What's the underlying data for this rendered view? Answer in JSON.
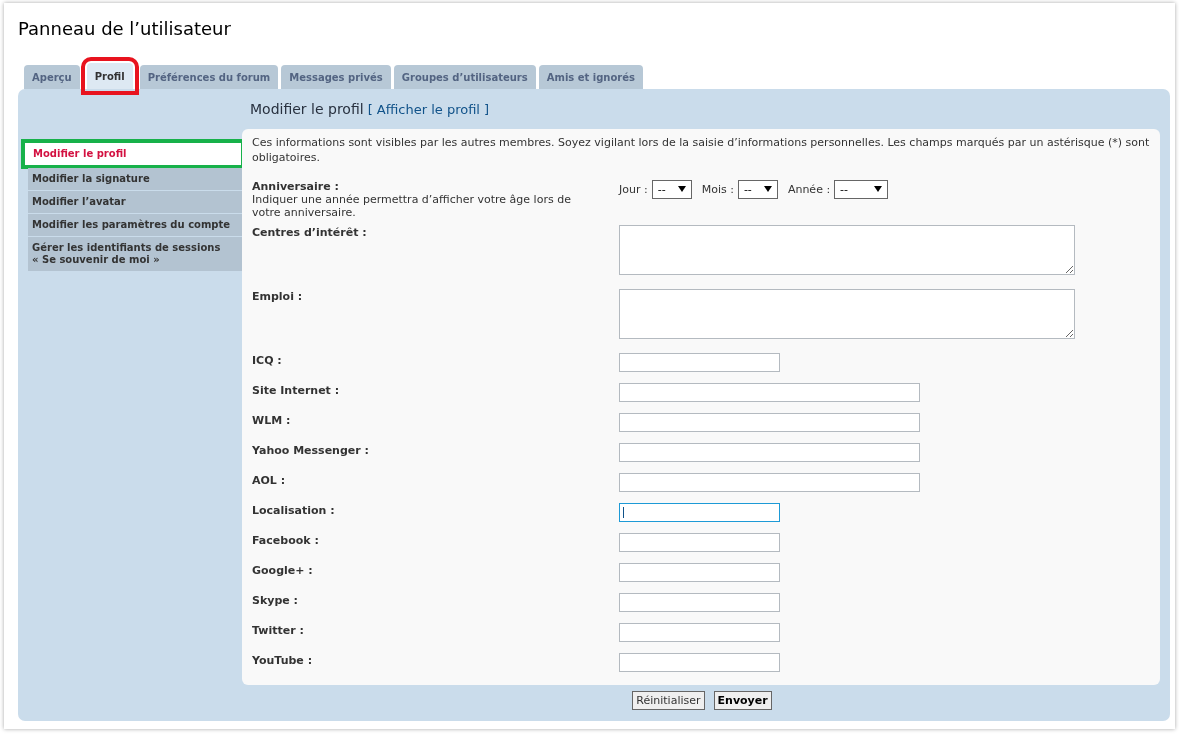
{
  "page_title": "Panneau de l’utilisateur",
  "tabs": [
    {
      "label": "Aperçu",
      "selected": false
    },
    {
      "label": "Profil",
      "selected": true
    },
    {
      "label": "Préférences du forum",
      "selected": false
    },
    {
      "label": "Messages privés",
      "selected": false
    },
    {
      "label": "Groupes d’utilisateurs",
      "selected": false
    },
    {
      "label": "Amis et ignorés",
      "selected": false
    }
  ],
  "heading": {
    "title": "Modifier le profil",
    "link": "[ Afficher le profil ]"
  },
  "sidebar": {
    "items": [
      {
        "label": "Modifier le profil",
        "selected": true
      },
      {
        "label": "Modifier la signature",
        "selected": false
      },
      {
        "label": "Modifier l’avatar",
        "selected": false
      },
      {
        "label": "Modifier les paramètres du compte",
        "selected": false
      },
      {
        "label": "Gérer les identifiants de sessions\n« Se souvenir de moi »",
        "selected": false
      }
    ]
  },
  "intro": "Ces informations sont visibles par les autres membres. Soyez vigilant lors de la saisie d’informations personnelles. Les champs marqués par un astérisque (*) sont obligatoires.",
  "fields": [
    {
      "kind": "date",
      "label": "Anniversaire :",
      "hint": "Indiquer une année permettra d’afficher votre âge lors de votre anniversaire.",
      "selects": [
        {
          "label": "Jour :",
          "value": "--"
        },
        {
          "label": "Mois :",
          "value": "--"
        },
        {
          "label": "Année :",
          "value": "--"
        }
      ]
    },
    {
      "kind": "textarea",
      "label": "Centres d’intérêt :"
    },
    {
      "kind": "textarea",
      "label": "Emploi :"
    },
    {
      "kind": "short",
      "label": "ICQ :",
      "focused": false
    },
    {
      "kind": "long",
      "label": "Site Internet :",
      "focused": false
    },
    {
      "kind": "long",
      "label": "WLM :",
      "focused": false
    },
    {
      "kind": "long",
      "label": "Yahoo Messenger :",
      "focused": false
    },
    {
      "kind": "long",
      "label": "AOL :",
      "focused": false
    },
    {
      "kind": "short",
      "label": "Localisation :",
      "focused": true
    },
    {
      "kind": "short",
      "label": "Facebook :",
      "focused": false
    },
    {
      "kind": "short",
      "label": "Google+ :",
      "focused": false
    },
    {
      "kind": "short",
      "label": "Skype :",
      "focused": false
    },
    {
      "kind": "short",
      "label": "Twitter :",
      "focused": false
    },
    {
      "kind": "short",
      "label": "YouTube :",
      "focused": false
    }
  ],
  "buttons": [
    {
      "label": "Réinitialiser",
      "kind": "reset"
    },
    {
      "label": "Envoyer",
      "kind": "submit"
    }
  ]
}
